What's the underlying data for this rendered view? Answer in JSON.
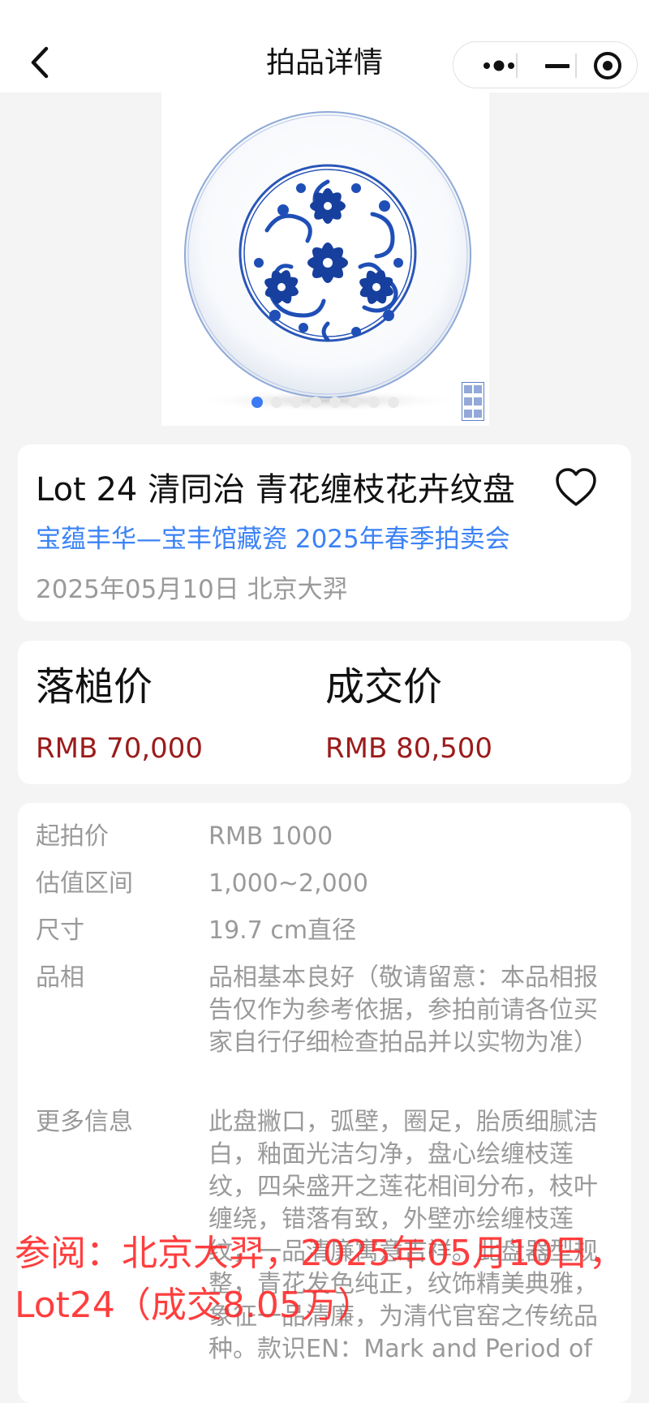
{
  "nav": {
    "title": "拍品详情"
  },
  "lot": {
    "title": "Lot 24 清同治 青花缠枝花卉纹盘",
    "auction": "宝蕴丰华—宝丰馆藏瓷 2025年春季拍卖会",
    "date_place": "2025年05月10日 北京大羿"
  },
  "prices": {
    "hammer_label": "落槌价",
    "hammer_value": "RMB 70,000",
    "final_label": "成交价",
    "final_value": "RMB 80,500"
  },
  "details": [
    {
      "key": "起拍价",
      "value": "RMB 1000"
    },
    {
      "key": "估值区间",
      "value": "1,000~2,000"
    },
    {
      "key": "尺寸",
      "value": "19.7 cm直径"
    },
    {
      "key": "品相",
      "value": "品相基本良好（敬请留意：本品相报告仅作为参考依据，参拍前请各位买家自行仔细检查拍品并以实物为准）"
    },
    {
      "key": "更多信息",
      "value": "此盘撇口，弧壁，圈足，胎质细腻洁白，釉面光洁匀净，盘心绘缠枝莲纹，四朵盛开之莲花相间分布，枝叶缠绕，错落有致，外壁亦绘缠枝莲纹，一品清廉寓意吉祥。此盘器型规整，青花发色纯正，纹饰精美典雅，象征一品清廉，为清代官窑之传统品种。款识EN：Mark and Period of"
    }
  ],
  "watermark": "参阅：北京大羿，2025年05月10日，Lot24（成交8.05万）",
  "colors": {
    "accent_blue": "#3b82f6",
    "price_red": "#9b1b1b",
    "watermark_red": "#ff2a2a"
  },
  "icons": {
    "back": "chevron-left-icon",
    "more": "more-dots-icon",
    "minimize": "minimize-icon",
    "close": "target-close-icon",
    "favorite": "heart-icon"
  },
  "carousel": {
    "total": 8,
    "active": 1
  }
}
